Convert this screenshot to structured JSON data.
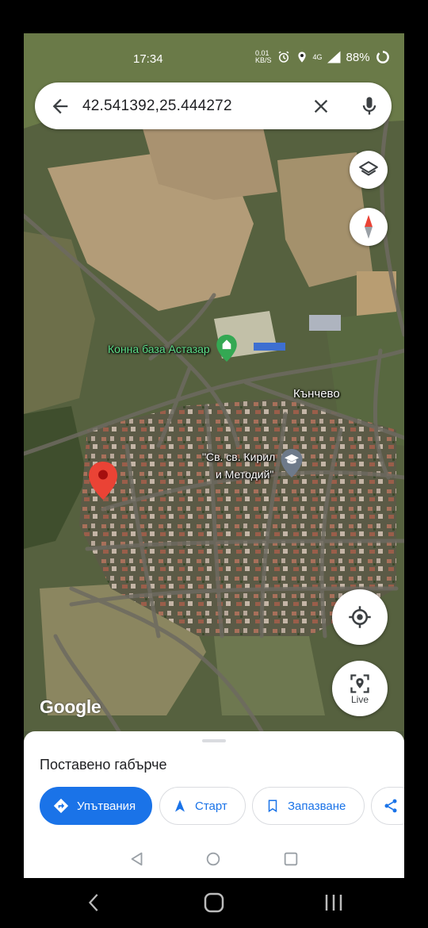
{
  "status": {
    "time": "17:34",
    "data_speed": "0.01\nKB/S",
    "network": "4G",
    "battery": "88%"
  },
  "search": {
    "query": "42.541392,25.444272"
  },
  "map": {
    "labels": {
      "stable": "Конна база Астазар",
      "village": "Кънчево",
      "school_line1": "\"Св. св. Кирил",
      "school_line2": "и Методий\""
    },
    "live_label": "Live",
    "logo": "Google"
  },
  "sheet": {
    "title": "Поставено габърче",
    "actions": {
      "directions": "Упътвания",
      "start": "Старт",
      "save": "Запазване"
    }
  },
  "colors": {
    "accent": "#1a73e8",
    "pin": "#ea4335",
    "poi_green": "#34a853"
  }
}
